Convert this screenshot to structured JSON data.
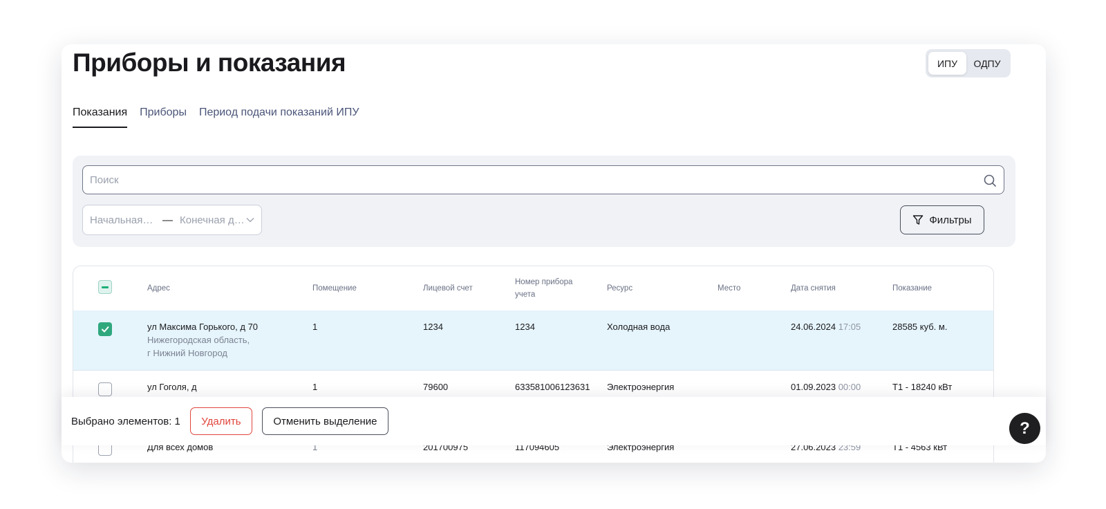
{
  "header": {
    "title": "Приборы и показания"
  },
  "meter_type_toggle": {
    "options": [
      "ИПУ",
      "ОДПУ"
    ],
    "selected": "ИПУ"
  },
  "tabs": [
    {
      "label": "Показания",
      "active": true
    },
    {
      "label": "Приборы",
      "active": false
    },
    {
      "label": "Период подачи показаний ИПУ",
      "active": false
    }
  ],
  "filters": {
    "search_placeholder": "Поиск",
    "date_start_placeholder": "Начальная дата",
    "date_separator": "—",
    "date_end_placeholder": "Конечная дата",
    "filters_button": "Фильтры"
  },
  "table": {
    "columns": {
      "address": "Адрес",
      "room": "Помещение",
      "account": "Лицевой счет",
      "meter_number": "Номер прибора учета",
      "resource": "Ресурс",
      "place": "Место",
      "date": "Дата снятия",
      "reading": "Показание"
    },
    "rows": [
      {
        "selected": true,
        "street": "ул Максима Горького, д 70",
        "region": "Нижегородская область,",
        "city": "г Нижний Новгород",
        "room": "1",
        "account": "1234",
        "meter_number": "1234",
        "resource": "Холодная вода",
        "place": "",
        "date": "24.06.2024",
        "time": "17:05",
        "reading": "28585 куб. м."
      },
      {
        "selected": false,
        "street": "ул Гоголя, д",
        "room": "1",
        "account": "79600",
        "meter_number": "633581006123631",
        "resource": "Электроэнергия",
        "place": "",
        "date": "01.09.2023",
        "time": "00:00",
        "reading": "Т1 - 18240 кВт"
      },
      {
        "selected": false,
        "street": "Для всех домов",
        "room": "1",
        "account": "201700975",
        "meter_number": "117094605",
        "resource": "Электроэнергия",
        "place": "",
        "date": "27.06.2023",
        "time": "23:59",
        "reading": "Т1 - 4563 кВт"
      }
    ]
  },
  "selection_bar": {
    "count_text": "Выбрано элементов: 1",
    "delete_button": "Удалить",
    "cancel_button": "Отменить выделение"
  },
  "help_button": {
    "label": "?"
  },
  "colors": {
    "accent_green": "#2fa87e",
    "danger_red": "#e0443b",
    "selected_row_bg": "#e6f5fc",
    "panel_bg": "#f0f2f6"
  }
}
